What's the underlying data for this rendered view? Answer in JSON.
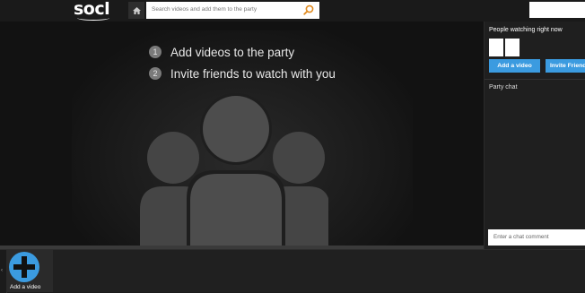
{
  "header": {
    "logo": "socl",
    "home_icon": "home-icon",
    "search_placeholder": "Search videos and add them to the party",
    "search_icon": "search-icon"
  },
  "player": {
    "steps": [
      {
        "num": "1",
        "text": "Add videos to the party"
      },
      {
        "num": "2",
        "text": "Invite friends to watch with you"
      }
    ],
    "illustration_icon": "group-people-icon"
  },
  "sidebar": {
    "watching_title": "People watching right now",
    "add_video_button": "Add a video",
    "invite_button": "Invite Friends",
    "chat_title": "Party chat",
    "chat_placeholder": "Enter a chat comment"
  },
  "bottom": {
    "add_tile_label": "Add a video",
    "add_icon": "plus-icon",
    "edge_icon": "chevron-left-icon"
  },
  "colors": {
    "accent": "#3b9be0",
    "background": "#121212"
  }
}
